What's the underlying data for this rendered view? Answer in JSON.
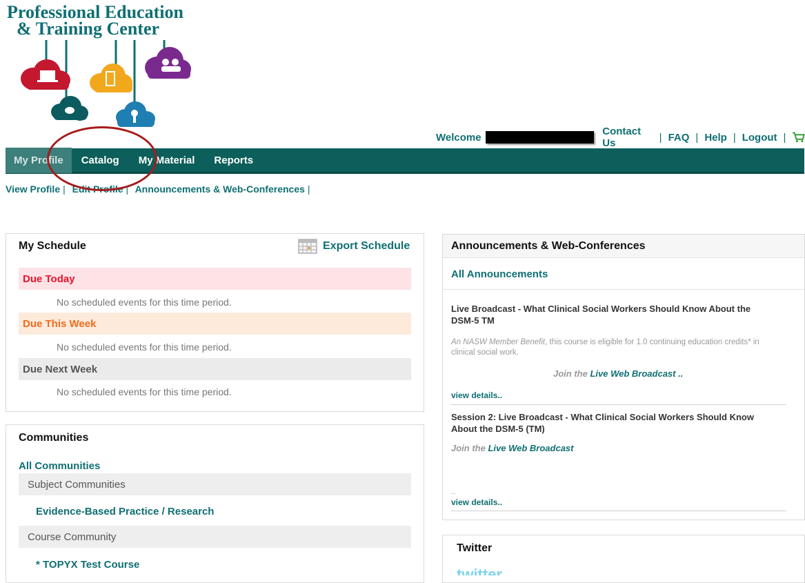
{
  "logo": {
    "line1": "Professional Education",
    "line2": "& Training Center"
  },
  "header": {
    "welcome": "Welcome",
    "links": [
      "Contact Us",
      "FAQ",
      "Help",
      "Logout"
    ],
    "cart_icon": "cart-icon"
  },
  "nav": {
    "items": [
      "My Profile",
      "Catalog",
      "My Material",
      "Reports"
    ],
    "active": "My Profile"
  },
  "subnav": {
    "items": [
      "View Profile",
      "Edit Profile",
      "Announcements & Web-Conferences"
    ]
  },
  "schedule": {
    "title": "My Schedule",
    "export_label": "Export Schedule",
    "rows": [
      {
        "label": "Due Today",
        "empty": "No scheduled events for this time period."
      },
      {
        "label": "Due This Week",
        "empty": "No scheduled events for this time period."
      },
      {
        "label": "Due Next Week",
        "empty": "No scheduled events for this time period."
      }
    ],
    "colors": {
      "today_bg": "#fde3e6",
      "today_fg": "#e8132a",
      "week_bg": "#fdeadb",
      "week_fg": "#f26b1d",
      "next_bg": "#ebebeb",
      "next_fg": "#555555"
    }
  },
  "communities": {
    "title": "Communities",
    "all_link": "All Communities",
    "group1": "Subject Communities",
    "group1_link": "Evidence-Based Practice / Research",
    "group2": "Course Community",
    "group2_link": "* TOPYX Test Course"
  },
  "announcements": {
    "title": "Announcements & Web-Conferences",
    "all_link": "All Announcements",
    "items": [
      {
        "title": "Live Broadcast - What Clinical Social Workers Should Know About the DSM-5 TM",
        "body_em": "An NASW Member Benefit",
        "body_rest": ", this course is eligible for 1.0 continuing education credits* in clinical social work.",
        "join_prefix": "Join the",
        "join_link": "Live Web Broadcast",
        "join_suffix": " ..",
        "details": "view details.."
      },
      {
        "title": "Session 2: Live Broadcast - What Clinical Social Workers Should Know About the DSM-5 (TM)",
        "join_prefix": "Join the",
        "join_link": "Live Web Broadcast",
        "dots": "..",
        "details": "view details.."
      }
    ]
  },
  "twitter": {
    "title": "Twitter",
    "logo_text": "twitter"
  },
  "brand": {
    "teal": "#0f6f73",
    "nav_bg": "#0d5f5b",
    "annotation_red": "#a51c1c"
  }
}
